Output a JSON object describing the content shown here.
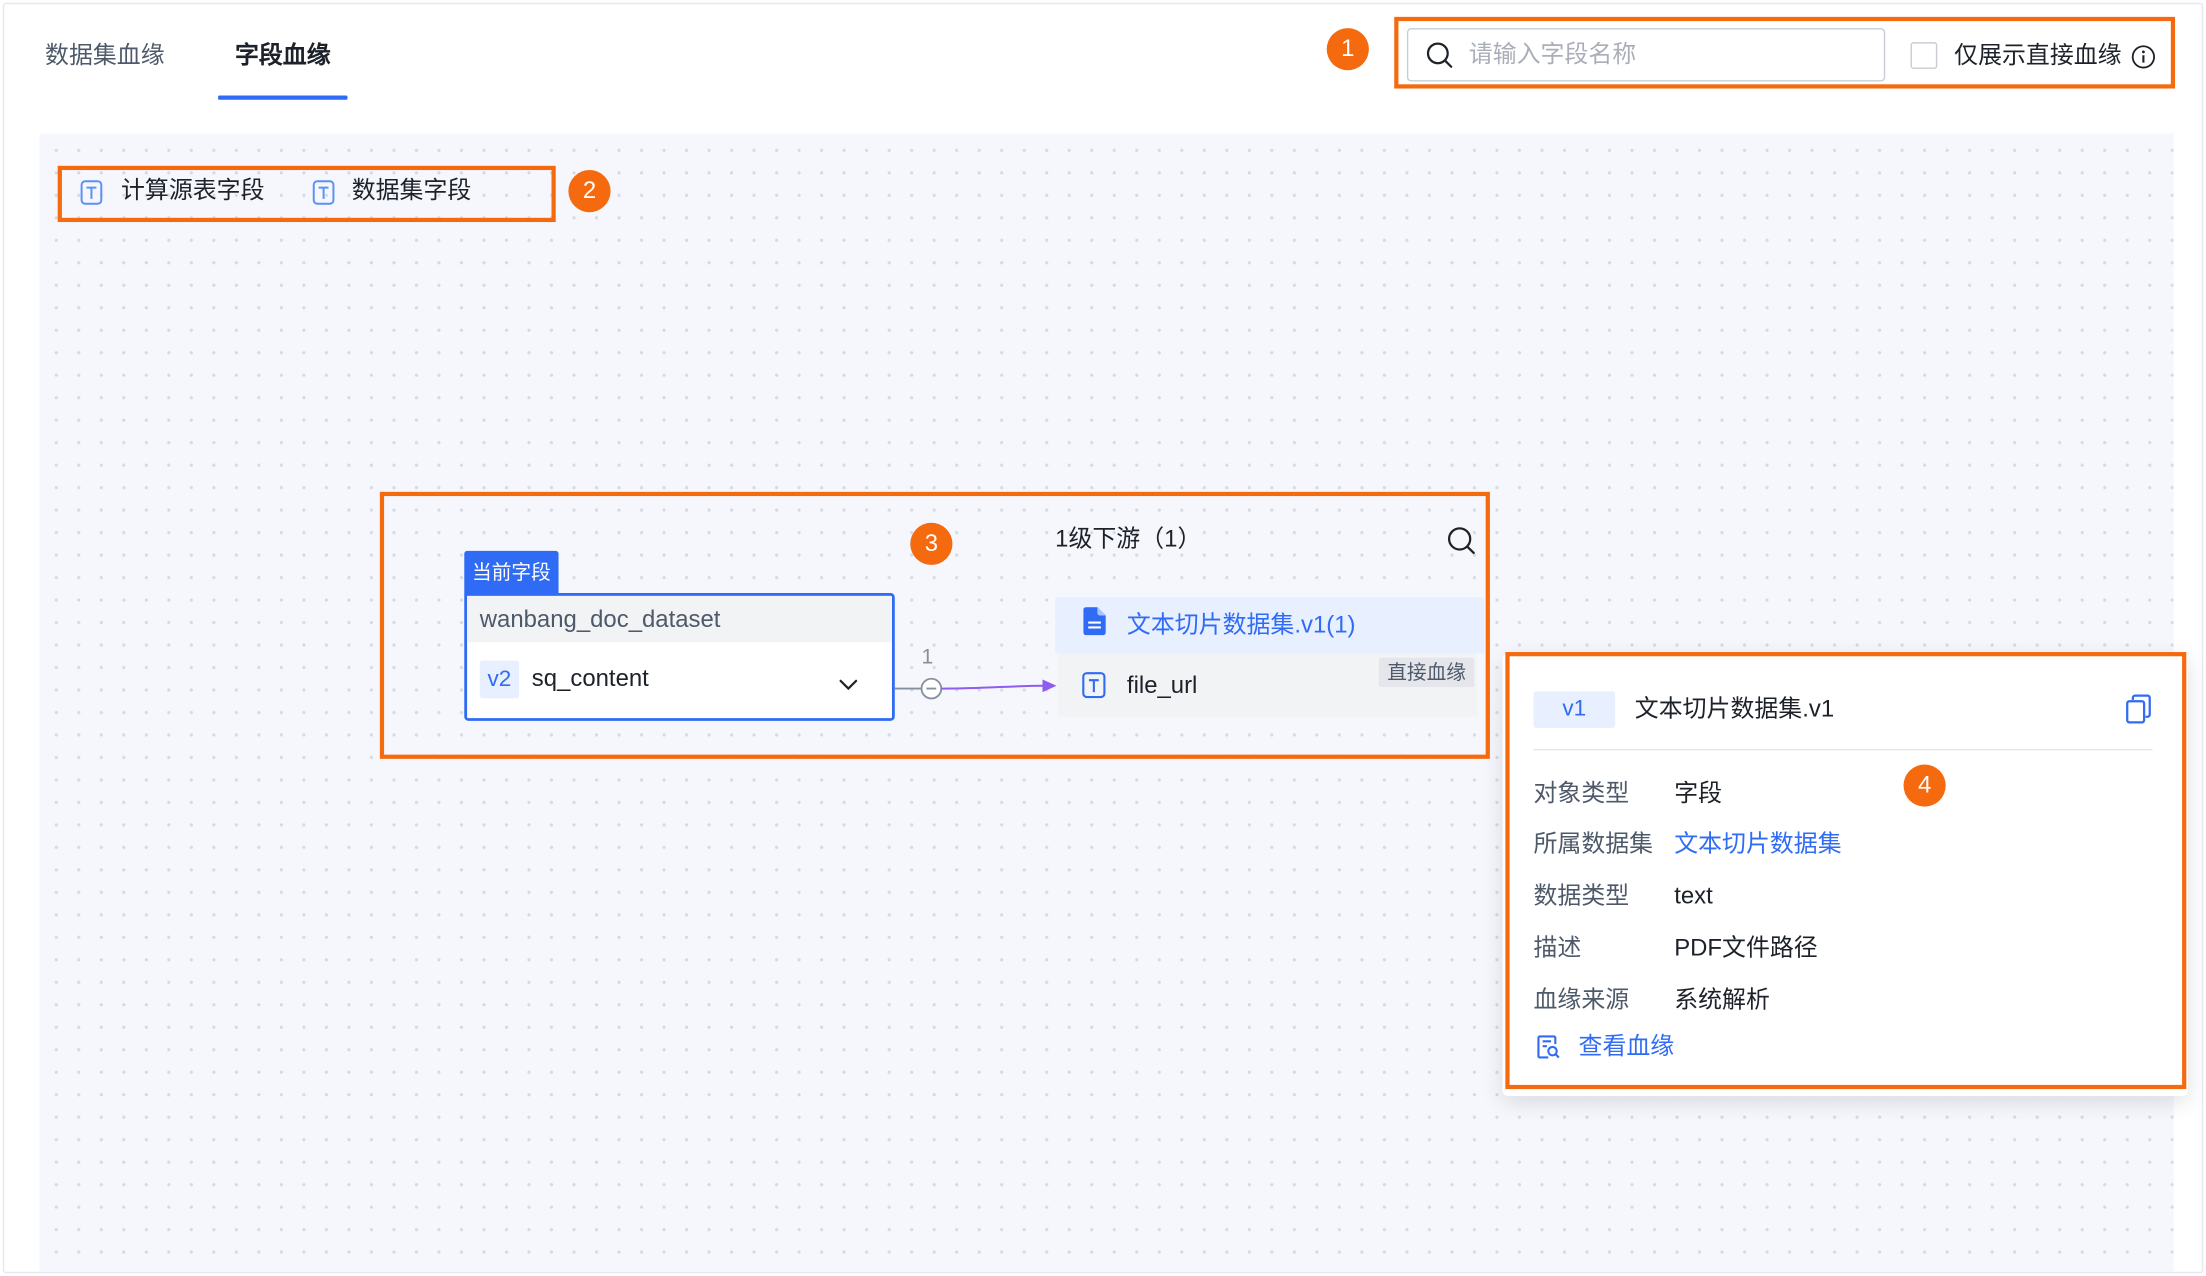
{
  "tabs": [
    {
      "label": "数据集血缘",
      "active": false
    },
    {
      "label": "字段血缘",
      "active": true
    }
  ],
  "search": {
    "placeholder": "请输入字段名称",
    "value": ""
  },
  "direct_only": {
    "label": "仅展示直接血缘",
    "checked": false
  },
  "legend": [
    {
      "label": "计算源表字段",
      "icon": "text-field-icon"
    },
    {
      "label": "数据集字段",
      "icon": "text-field-icon"
    }
  ],
  "callouts": [
    "1",
    "2",
    "3",
    "4"
  ],
  "current_field": {
    "tag": "当前字段",
    "dataset": "wanbang_doc_dataset",
    "version": "v2",
    "field": "sq_content"
  },
  "edge": {
    "label": "1"
  },
  "downstream": {
    "title": "1级下游（1）",
    "dataset": "文本切片数据集.v1(1)",
    "field": "file_url",
    "badge": "直接血缘"
  },
  "detail": {
    "version": "v1",
    "name": "文本切片数据集.v1",
    "rows": [
      {
        "label": "对象类型",
        "value": "字段"
      },
      {
        "label": "所属数据集",
        "value": "文本切片数据集"
      },
      {
        "label": "数据类型",
        "value": "text"
      },
      {
        "label": "描述",
        "value": "PDF文件路径"
      },
      {
        "label": "血缘来源",
        "value": "系统解析"
      }
    ],
    "link": "查看血缘"
  },
  "icons": {
    "search": "search-icon",
    "info": "info-icon",
    "field": "text-field-icon",
    "dataset": "document-icon",
    "copy": "copy-icon",
    "expand": "chevron-down-icon",
    "collapse": "minus-circle-icon",
    "view_lineage": "document-search-icon"
  },
  "colors": {
    "accent": "#2f6bf5",
    "callout": "#f5690f",
    "edge": "#8e5cf0",
    "text": "#1d2129",
    "muted": "#4e5969"
  }
}
